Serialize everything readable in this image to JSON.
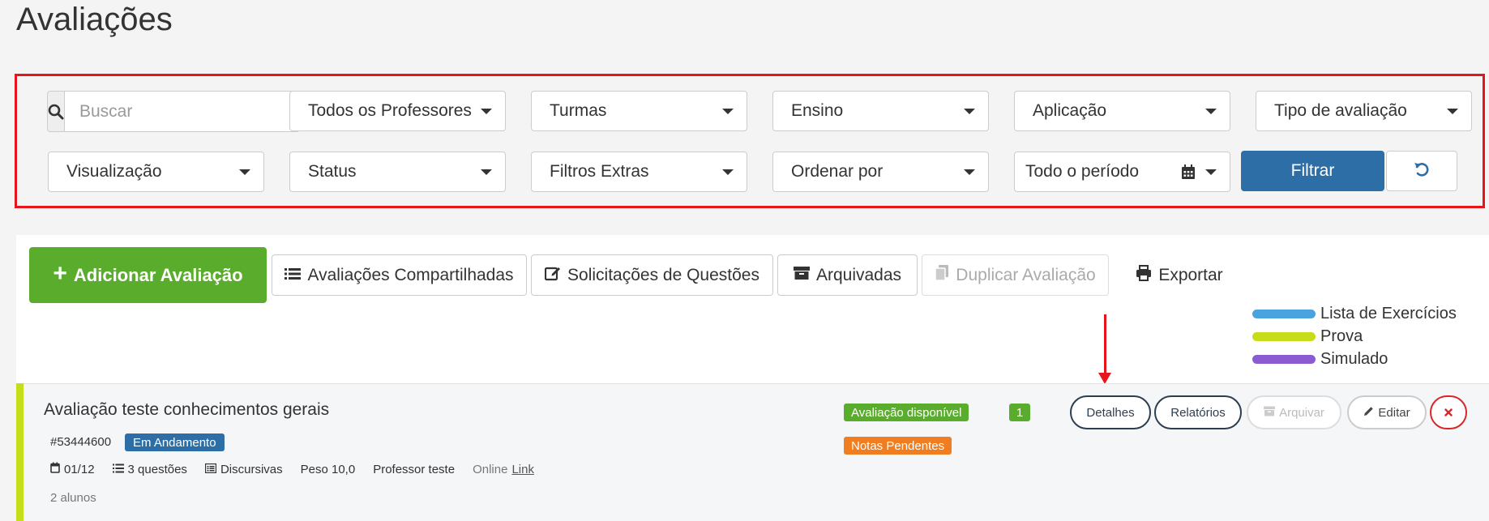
{
  "page": {
    "title": "Avaliações"
  },
  "filters": {
    "search": {
      "placeholder": "Buscar",
      "value": "",
      "icon": "search-icon"
    },
    "professores": "Todos os Professores",
    "turmas": "Turmas",
    "ensino": "Ensino",
    "aplicacao": "Aplicação",
    "tipo_avaliacao": "Tipo de avaliação",
    "visualizacao": "Visualização",
    "status": "Status",
    "filtros_extras": "Filtros Extras",
    "ordenar_por": "Ordenar por",
    "periodo": "Todo o período",
    "filtrar_label": "Filtrar",
    "reset_icon": "undo-icon"
  },
  "toolbar": {
    "add_label": "Adicionar Avaliação",
    "compartilhadas_label": "Avaliações Compartilhadas",
    "solicitacoes_label": "Solicitações de Questões",
    "arquivadas_label": "Arquivadas",
    "duplicar_label": "Duplicar Avaliação",
    "exportar_label": "Exportar"
  },
  "legend": [
    {
      "label": "Lista de Exercícios",
      "color": "#4aa3df"
    },
    {
      "label": "Prova",
      "color": "#c6de1a"
    },
    {
      "label": "Simulado",
      "color": "#8a5bd1"
    }
  ],
  "evaluation": {
    "title": "Avaliação teste conhecimentos gerais",
    "id": "#53444600",
    "status_badge": "Em Andamento",
    "availability_badge": "Avaliação disponível",
    "grades_badge": "Notas Pendentes",
    "count_badge": "1",
    "date": "01/12",
    "questions": "3 questões",
    "type": "Discursivas",
    "weight": "Peso 10,0",
    "teacher": "Professor teste",
    "mode": "Online",
    "link_label": "Link",
    "students": "2 alunos",
    "stripe_color": "#c6de1a",
    "actions": {
      "detalhes": "Detalhes",
      "relatorios": "Relatórios",
      "arquivar": "Arquivar",
      "editar": "Editar"
    }
  },
  "colors": {
    "primary": "#2e6ea6",
    "success": "#5aad2c",
    "warning": "#f07d1f",
    "danger": "#d9262b",
    "highlight": "#e8141b"
  }
}
